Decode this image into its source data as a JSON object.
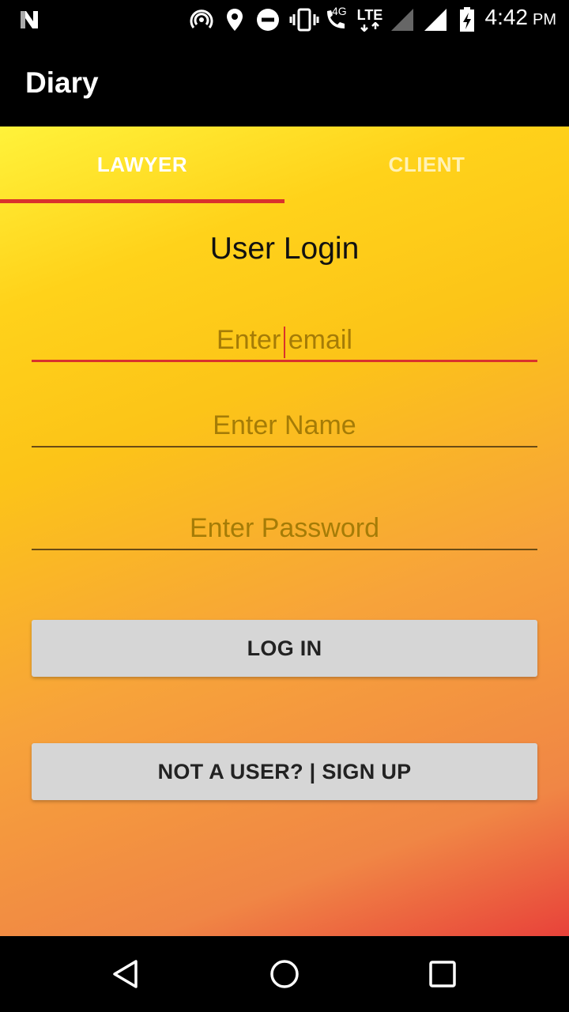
{
  "status_bar": {
    "time": "4:42",
    "ampm": "PM",
    "network_4g": "4G",
    "network_lte": "LTE",
    "icons": [
      "n-notification-icon",
      "hotspot-icon",
      "location-icon",
      "do-not-disturb-icon",
      "vibrate-icon",
      "wifi-calling-icon",
      "signal-icon",
      "signal-full-icon",
      "battery-charging-icon"
    ]
  },
  "app_bar": {
    "title": "Diary"
  },
  "tabs": [
    {
      "label": "LAWYER",
      "selected": true
    },
    {
      "label": "CLIENT",
      "selected": false
    }
  ],
  "login": {
    "title": "User Login",
    "email_placeholder": "Enter email",
    "name_placeholder": "Enter Name",
    "password_placeholder": "Enter Password",
    "login_label": "LOG IN",
    "signup_label": "NOT A USER? | SIGN UP"
  },
  "colors": {
    "accent": "#d9322c",
    "button_bg": "#d6d6d6",
    "gradient_top": "#fff23a",
    "gradient_bottom": "#e8423a"
  },
  "nav_bar": {
    "icons": [
      "back-icon",
      "home-icon",
      "recents-icon"
    ]
  }
}
